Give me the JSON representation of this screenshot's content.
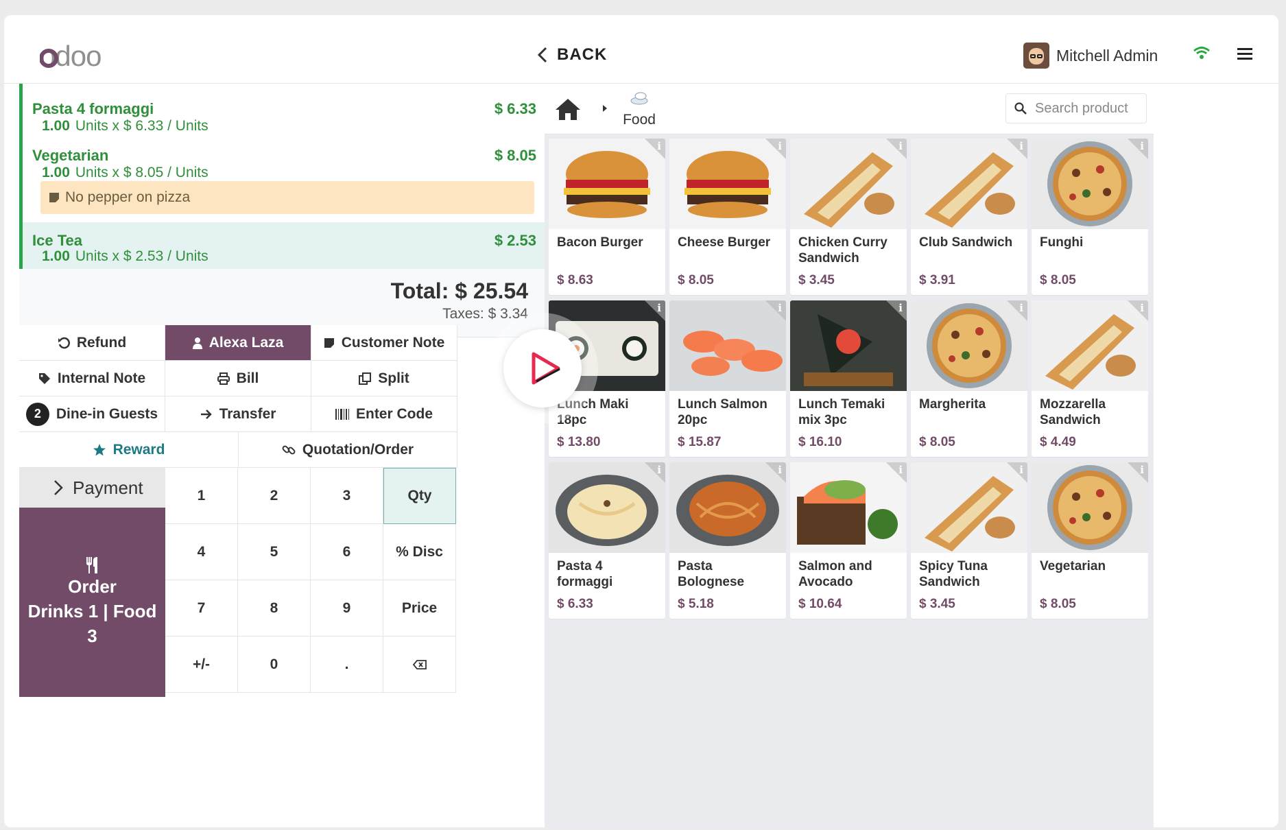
{
  "header": {
    "logo_text": "odoo",
    "back_label": "BACK",
    "user_name": "Mitchell Admin"
  },
  "order": {
    "lines": [
      {
        "name": "Pasta 4 formaggi",
        "qty": "1.00",
        "unit_text": "Units x $ 6.33 / Units",
        "price": "$ 6.33"
      },
      {
        "name": "Vegetarian",
        "qty": "1.00",
        "unit_text": "Units x $ 8.05 / Units",
        "price": "$ 8.05",
        "note": "No pepper on pizza"
      },
      {
        "name": "Ice Tea",
        "qty": "1.00",
        "unit_text": "Units x $ 2.53 / Units",
        "price": "$ 2.53",
        "selected": true
      }
    ],
    "total": "Total: $ 25.54",
    "taxes": "Taxes: $ 3.34"
  },
  "controls": {
    "refund": "Refund",
    "customer": "Alexa Laza",
    "customer_note": "Customer Note",
    "internal_note": "Internal Note",
    "bill": "Bill",
    "split": "Split",
    "guests_count": "2",
    "guests": "Dine-in Guests",
    "transfer": "Transfer",
    "enter_code": "Enter Code",
    "reward": "Reward",
    "quotation": "Quotation/Order"
  },
  "numpad": {
    "payment": "Payment",
    "order_line1": "Order",
    "order_line2": "Drinks 1 | Food",
    "order_line3": "3",
    "keys": [
      "1",
      "2",
      "3",
      "Qty",
      "4",
      "5",
      "6",
      "% Disc",
      "7",
      "8",
      "9",
      "Price",
      "+/-",
      "0",
      ".",
      ""
    ]
  },
  "category": {
    "current": "Food",
    "search_placeholder": "Search product"
  },
  "products": [
    {
      "name": "Bacon Burger",
      "price": "$ 8.63",
      "img": "burger"
    },
    {
      "name": "Cheese Burger",
      "price": "$ 8.05",
      "img": "burger"
    },
    {
      "name": "Chicken Curry Sandwich",
      "price": "$ 3.45",
      "img": "sandwich"
    },
    {
      "name": "Club Sandwich",
      "price": "$ 3.91",
      "img": "sandwich"
    },
    {
      "name": "Funghi",
      "price": "$ 8.05",
      "img": "pizza"
    },
    {
      "name": "Lunch Maki 18pc",
      "price": "$ 13.80",
      "img": "sushi"
    },
    {
      "name": "Lunch Salmon 20pc",
      "price": "$ 15.87",
      "img": "salmon"
    },
    {
      "name": "Lunch Temaki mix 3pc",
      "price": "$ 16.10",
      "img": "temaki"
    },
    {
      "name": "Margherita",
      "price": "$ 8.05",
      "img": "pizza"
    },
    {
      "name": "Mozzarella Sandwich",
      "price": "$ 4.49",
      "img": "sandwich"
    },
    {
      "name": "Pasta 4 formaggi",
      "price": "$ 6.33",
      "img": "pasta"
    },
    {
      "name": "Pasta Bolognese",
      "price": "$ 5.18",
      "img": "bolognese"
    },
    {
      "name": "Salmon and Avocado",
      "price": "$ 10.64",
      "img": "avocado"
    },
    {
      "name": "Spicy Tuna Sandwich",
      "price": "$ 3.45",
      "img": "sandwich"
    },
    {
      "name": "Vegetarian",
      "price": "$ 8.05",
      "img": "pizza"
    }
  ],
  "colors": {
    "brand": "#714b67",
    "line_text": "#2f8f3a",
    "selected_line_bg": "#e5f2f2",
    "note_bg": "#fde5c1"
  }
}
